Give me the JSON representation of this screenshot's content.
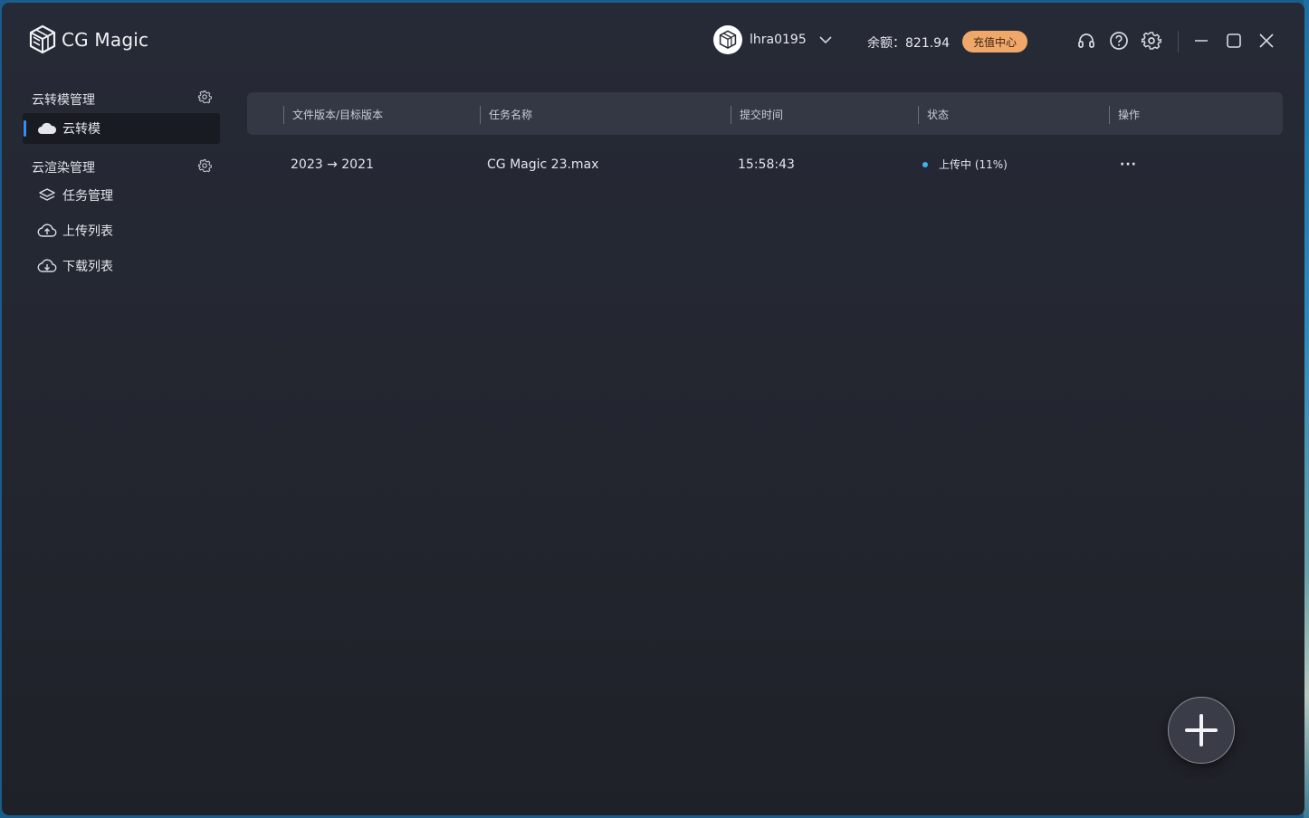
{
  "app": {
    "name": "CG Magic",
    "logo_icon": "cube-logo-icon"
  },
  "header": {
    "username": "lhra0195",
    "balance_label": "余额：",
    "balance_value": "821.94",
    "recharge_label": "充值中心",
    "recharge_color": "#f0a86a",
    "icons": [
      "headset-icon",
      "help-icon",
      "settings-icon",
      "minimize-icon",
      "maximize-icon",
      "close-icon"
    ]
  },
  "sidebar": {
    "section1_title": "云转模管理",
    "section1_items": [
      {
        "label": "云转模",
        "icon": "cloud-icon",
        "active": true
      }
    ],
    "section2_title": "云渲染管理",
    "section2_items": [
      {
        "label": "任务管理",
        "icon": "layers-icon"
      },
      {
        "label": "上传列表",
        "icon": "cloud-upload-icon"
      },
      {
        "label": "下载列表",
        "icon": "cloud-download-icon"
      }
    ],
    "accent_color": "#3b8cf0"
  },
  "table": {
    "columns": [
      "文件版本/目标版本",
      "任务名称",
      "提交时间",
      "状态",
      "操作"
    ],
    "rows": [
      {
        "version": "2023 → 2021",
        "task_name": "CG Magic 23.max",
        "submit_time": "15:58:43",
        "status": "上传中 (11%)",
        "status_color": "#3fb4ea",
        "action": "···"
      }
    ]
  },
  "fab": {
    "icon": "plus-icon"
  }
}
